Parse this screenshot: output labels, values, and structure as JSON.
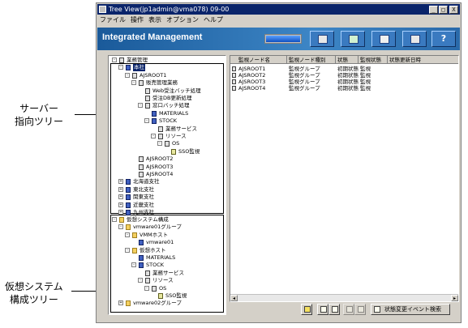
{
  "annotations": {
    "server_tree": [
      "サーバー",
      "指向ツリー"
    ],
    "virtual_tree": [
      "仮想システム",
      "構成ツリー"
    ]
  },
  "window": {
    "title": "Tree View(jp1admin@vma078) 09-00",
    "controls": [
      "_",
      "□",
      "X"
    ]
  },
  "menu": [
    "ファイル",
    "操作",
    "表示",
    "オプション",
    "ヘルプ"
  ],
  "banner": {
    "title": "Integrated Management",
    "progress": 1.0,
    "buttons": [
      "monitor-icon",
      "chart-icon",
      "settings-icon",
      "window-icon",
      "help-icon"
    ],
    "help_label": "?"
  },
  "server_tree": [
    {
      "label": "業務管理",
      "icon": "server",
      "expand": "-"
    },
    {
      "label": "本社",
      "icon": "blue",
      "expand": "-",
      "selected": true
    },
    {
      "label": "AJSROOT1",
      "icon": "server",
      "expand": "-"
    },
    {
      "label": "販売管理業務",
      "icon": "server",
      "expand": "-"
    },
    {
      "label": "Web受注バッチ処理",
      "icon": "server"
    },
    {
      "label": "受注DB更新処理",
      "icon": "server"
    },
    {
      "label": "窓口バッチ処理",
      "icon": "server",
      "expand": "-"
    },
    {
      "label": "MATERIALS",
      "icon": "blue"
    },
    {
      "label": "STOCK",
      "icon": "blue",
      "expand": "-"
    },
    {
      "label": "業務サービス",
      "icon": "server"
    },
    {
      "label": "リソース",
      "icon": "server",
      "expand": "-"
    },
    {
      "label": "OS",
      "icon": "server",
      "expand": "-"
    },
    {
      "label": "SSO監視",
      "icon": "mon"
    },
    {
      "label": "AJSROOT2",
      "icon": "server"
    },
    {
      "label": "AJSROOT3",
      "icon": "server"
    },
    {
      "label": "AJSROOT4",
      "icon": "server"
    },
    {
      "label": "北海道支社",
      "icon": "blue",
      "expand": "+"
    },
    {
      "label": "東北支社",
      "icon": "blue",
      "expand": "+"
    },
    {
      "label": "関東支社",
      "icon": "blue",
      "expand": "+"
    },
    {
      "label": "近畿支社",
      "icon": "blue",
      "expand": "+"
    },
    {
      "label": "九州支社",
      "icon": "blue",
      "expand": "+"
    }
  ],
  "virtual_tree": [
    {
      "label": "仮想システム構成",
      "icon": "folder",
      "expand": "-"
    },
    {
      "label": "vmware01グループ",
      "icon": "folder",
      "expand": "-"
    },
    {
      "label": "VMMホスト",
      "icon": "folder",
      "expand": "-"
    },
    {
      "label": "vmware01",
      "icon": "blue"
    },
    {
      "label": "仮想ホスト",
      "icon": "folder",
      "expand": "-"
    },
    {
      "label": "MATERIALS",
      "icon": "blue"
    },
    {
      "label": "STOCK",
      "icon": "blue",
      "expand": "-"
    },
    {
      "label": "業務サービス",
      "icon": "server"
    },
    {
      "label": "リソース",
      "icon": "server",
      "expand": "-"
    },
    {
      "label": "OS",
      "icon": "server",
      "expand": "-"
    },
    {
      "label": "SSO監視",
      "icon": "mon"
    },
    {
      "label": "vmware02グループ",
      "icon": "folder",
      "expand": "+"
    }
  ],
  "list": {
    "columns": [
      "監視ノード名",
      "監視ノード種別",
      "状態",
      "監視状態",
      "状態更新日時"
    ],
    "rows": [
      [
        "AJSROOT1",
        "監視グループ",
        "初期状態",
        "監視"
      ],
      [
        "AJSROOT2",
        "監視グループ",
        "初期状態",
        "監視"
      ],
      [
        "AJSROOT3",
        "監視グループ",
        "初期状態",
        "監視"
      ],
      [
        "AJSROOT4",
        "監視グループ",
        "初期状態",
        "監視"
      ]
    ],
    "scroll_left": "◂",
    "scroll_right": "▸"
  },
  "bottom_bar": {
    "search_button": "状態変更イベント検索"
  }
}
